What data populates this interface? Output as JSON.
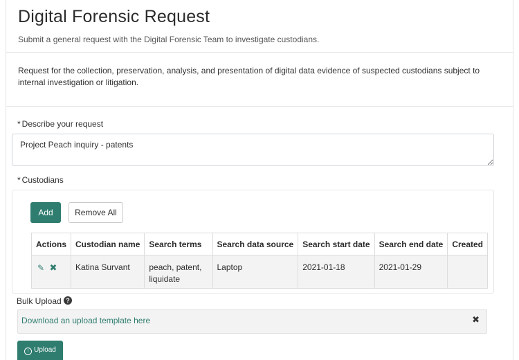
{
  "header": {
    "title": "Digital Forensic Request",
    "subtitle": "Submit a general request with the Digital Forensic Team to investigate custodians."
  },
  "description": "Request for the collection, preservation, analysis, and presentation of digital data evidence of suspected custodians subject to internal investigation or litigation.",
  "request_field": {
    "required_mark": "*",
    "label": "Describe your request",
    "value": "Project Peach inquiry - patents"
  },
  "custodians": {
    "required_mark": "*",
    "label": "Custodians",
    "add_label": "Add",
    "remove_all_label": "Remove All",
    "columns": [
      "Actions",
      "Custodian name",
      "Search terms",
      "Search data source",
      "Search start date",
      "Search end date",
      "Created"
    ],
    "rows": [
      {
        "custodian_name": "Katina Survant",
        "search_terms": "peach, patent, liquidate",
        "data_source": "Laptop",
        "start_date": "2021-01-18",
        "end_date": "2021-01-29",
        "created": ""
      }
    ]
  },
  "bulk_upload": {
    "label": "Bulk Upload",
    "help_icon": "question-circle-icon",
    "download_link": "Download an upload template here",
    "upload_label": "Upload"
  },
  "colors": {
    "accent": "#2e7d6f",
    "panel_bg": "#f3f3f3",
    "border": "#e4e4e4"
  }
}
